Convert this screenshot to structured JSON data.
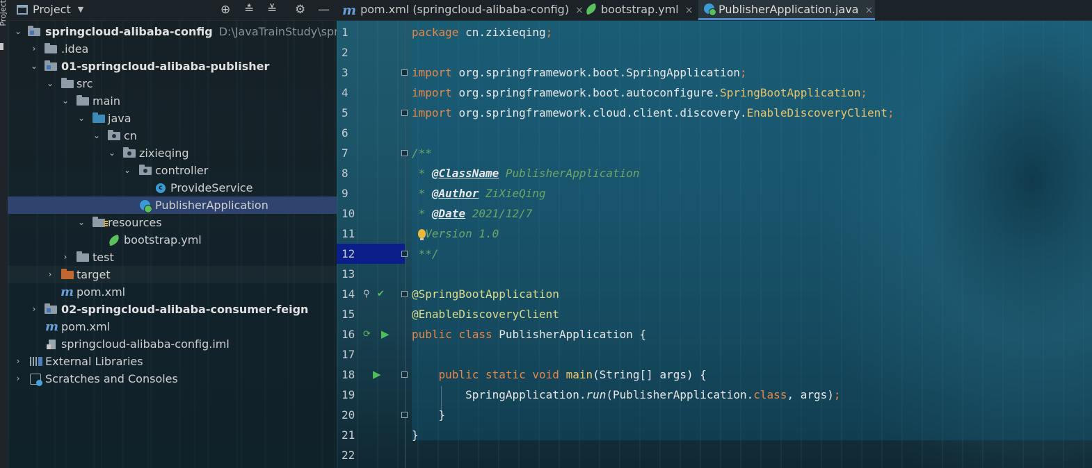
{
  "tool_strip": {
    "label": "Project"
  },
  "project_panel": {
    "title": "Project",
    "header_icons": [
      "locate-icon",
      "expand-all-icon",
      "collapse-all-icon",
      "gear-icon",
      "minimize-icon"
    ],
    "tree": [
      {
        "label": "springcloud-alibaba-config",
        "note": "D:\\JavaTrainStudy\\spring",
        "icon": "module-folder-icon",
        "expanded": true
      },
      {
        "label": ".idea",
        "icon": "folder-icon",
        "expanded": false
      },
      {
        "label": "01-springcloud-alibaba-publisher",
        "icon": "module-folder-icon",
        "expanded": true
      },
      {
        "label": "src",
        "icon": "folder-icon",
        "expanded": true
      },
      {
        "label": "main",
        "icon": "folder-icon",
        "expanded": true
      },
      {
        "label": "java",
        "icon": "source-folder-icon",
        "expanded": true
      },
      {
        "label": "cn",
        "icon": "package-icon",
        "expanded": true
      },
      {
        "label": "zixieqing",
        "icon": "package-icon",
        "expanded": true
      },
      {
        "label": "controller",
        "icon": "package-icon",
        "expanded": true
      },
      {
        "label": "ProvideService",
        "icon": "class-icon"
      },
      {
        "label": "PublisherApplication",
        "icon": "spring-boot-class-icon",
        "selected": true
      },
      {
        "label": "resources",
        "icon": "resources-folder-icon",
        "expanded": true
      },
      {
        "label": "bootstrap.yml",
        "icon": "spring-leaf-icon"
      },
      {
        "label": "test",
        "icon": "folder-icon",
        "expanded": false
      },
      {
        "label": "target",
        "icon": "excluded-folder-icon",
        "expanded": false
      },
      {
        "label": "pom.xml",
        "icon": "maven-icon"
      },
      {
        "label": "02-springcloud-alibaba-consumer-feign",
        "icon": "module-folder-icon",
        "expanded": false
      },
      {
        "label": "pom.xml",
        "icon": "maven-icon"
      },
      {
        "label": "springcloud-alibaba-config.iml",
        "icon": "iml-file-icon"
      },
      {
        "label": "External Libraries",
        "icon": "library-icon",
        "expanded": false
      },
      {
        "label": "Scratches and Consoles",
        "icon": "scratches-icon",
        "expanded": false
      }
    ]
  },
  "tabs": [
    {
      "label": "pom.xml (springcloud-alibaba-config)",
      "icon": "maven-icon",
      "active": false
    },
    {
      "label": "bootstrap.yml",
      "icon": "spring-leaf-icon",
      "active": false
    },
    {
      "label": "PublisherApplication.java",
      "icon": "spring-boot-class-icon",
      "active": true
    }
  ],
  "close_glyph": "×",
  "editor": {
    "current_line": 12,
    "lines": [
      {
        "n": "1",
        "text": "package cn.zixieqing;"
      },
      {
        "n": "2",
        "text": ""
      },
      {
        "n": "3",
        "text": "import org.springframework.boot.SpringApplication;"
      },
      {
        "n": "4",
        "text": "import org.springframework.boot.autoconfigure.SpringBootApplication;"
      },
      {
        "n": "5",
        "text": "import org.springframework.cloud.client.discovery.EnableDiscoveryClient;"
      },
      {
        "n": "6",
        "text": ""
      },
      {
        "n": "7",
        "text": "/**"
      },
      {
        "n": "8",
        "text": " * @ClassName PublisherApplication"
      },
      {
        "n": "9",
        "text": " * @Author ZiXieQing"
      },
      {
        "n": "10",
        "text": " * @Date 2021/12/7"
      },
      {
        "n": "11",
        "text": " * Version 1.0"
      },
      {
        "n": "12",
        "text": " **/"
      },
      {
        "n": "13",
        "text": ""
      },
      {
        "n": "14",
        "text": "@SpringBootApplication"
      },
      {
        "n": "15",
        "text": "@EnableDiscoveryClient"
      },
      {
        "n": "16",
        "text": "public class PublisherApplication {"
      },
      {
        "n": "17",
        "text": ""
      },
      {
        "n": "18",
        "text": "    public static void main(String[] args) {"
      },
      {
        "n": "19",
        "text": "        SpringApplication.run(PublisherApplication.class, args);"
      },
      {
        "n": "20",
        "text": "    }"
      },
      {
        "n": "21",
        "text": "}"
      },
      {
        "n": "22",
        "text": ""
      }
    ],
    "tokens": {
      "package": "package",
      "import": "import",
      "public": "public",
      "class": "class",
      "static": "static",
      "void": "void",
      "class_literal": "class",
      "pkg_name": "cn.zixieqing",
      "semi": ";",
      "imp3_pre": "org.springframework.boot.",
      "imp3_cls": "SpringApplication",
      "imp4_pre": "org.springframework.boot.autoconfigure.",
      "imp4_cls": "SpringBootApplication",
      "imp5_pre": "org.springframework.cloud.client.discovery.",
      "imp5_cls": "EnableDiscoveryClient",
      "doc_open": "/**",
      "doc_star": " * ",
      "doc_close": " **/",
      "tag_classname": "@ClassName",
      "val_classname": " PublisherApplication",
      "tag_author": "@Author",
      "val_author": " ZiXieQing",
      "tag_date": "@Date",
      "val_date": " 2021/12/7",
      "version": "Version 1.0",
      "ann1": "@SpringBootApplication",
      "ann2": "@EnableDiscoveryClient",
      "class_name": " PublisherApplication {",
      "main_name": "main",
      "main_params": "(String[] args) {",
      "run_pre": "SpringApplication.",
      "run_name": "run",
      "run_args": "(PublisherApplication.",
      "run_tail": ", args)",
      "close_brace": "}"
    }
  }
}
